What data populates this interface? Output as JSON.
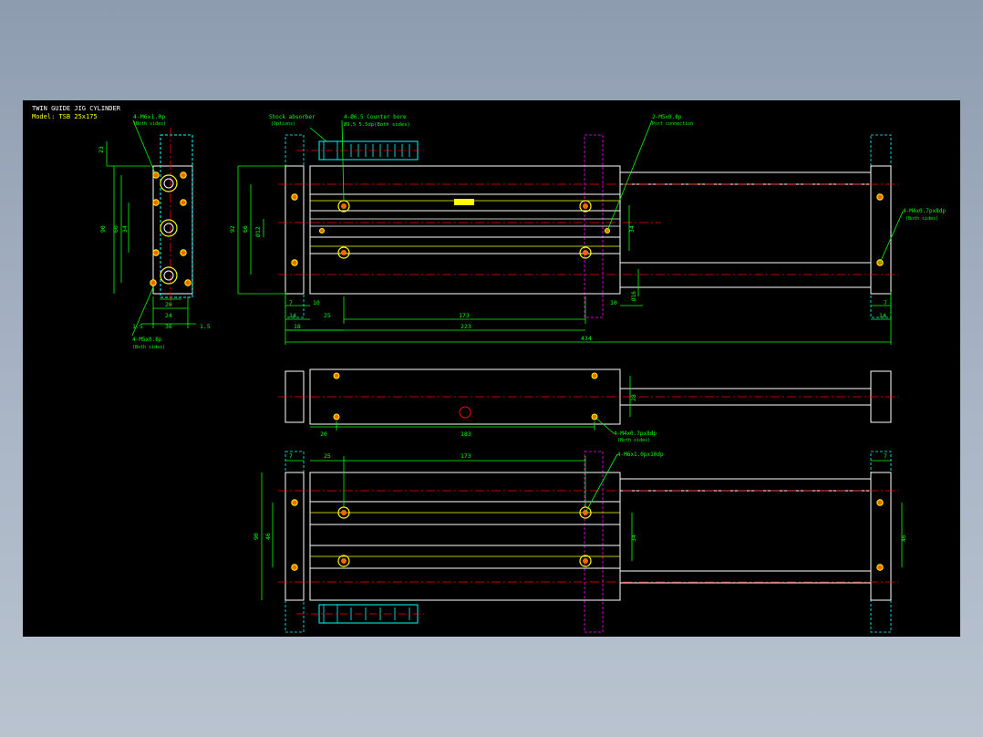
{
  "title_block": {
    "line1": "TWIN GUIDE JIG CYLINDER",
    "line2": "Model: TSB 25x175"
  },
  "callouts": {
    "end_view_top": {
      "label": "4-M6x1.0p",
      "sub": "(Both sides)"
    },
    "end_view_bottom": {
      "label": "4-M5x0.8p",
      "sub": "(Both sides)"
    },
    "shock_absorber": {
      "label": "Shock absorber",
      "sub": "(Options)"
    },
    "counter_bore": {
      "label": "4-Ø6.5 Counter bore",
      "sub": "Ø9.5 5.5dp(Both sides)"
    },
    "port": {
      "label": "2-M5x0.8p",
      "sub": "Port connection"
    },
    "right_plate": {
      "label": "4-M4x0.7px8dp",
      "sub": "(Both sides)"
    },
    "mid_view": {
      "label": "4-M4x0.7px8dp",
      "sub": "(Both sides)"
    },
    "bottom_view": {
      "label": "4-M6x1.0px10dp"
    }
  },
  "dimensions": {
    "end_view": [
      "23",
      "90",
      "60",
      "34",
      "20",
      "24",
      "36",
      "1.5",
      "1.5"
    ],
    "top_view": [
      "92",
      "66",
      "Ø12",
      "7",
      "10",
      "14",
      "25",
      "173",
      "10",
      "Ø16",
      "34",
      "7",
      "14",
      "18",
      "223",
      "434"
    ],
    "mid_view": [
      "28",
      "20",
      "183"
    ],
    "bottom_view": [
      "7",
      "25",
      "173",
      "7",
      "90",
      "46",
      "34",
      "46"
    ]
  },
  "colors": {
    "background": "#000000",
    "outline": "#ffffff",
    "dimension": "#00ff00",
    "centerline": "#ff0000",
    "hole": "#ffff00",
    "hidden": "#00ffff",
    "phantom": "#ff00ff"
  },
  "icons": {
    "hole": "threaded-hole-symbol",
    "shock": "shock-absorber-outline"
  }
}
